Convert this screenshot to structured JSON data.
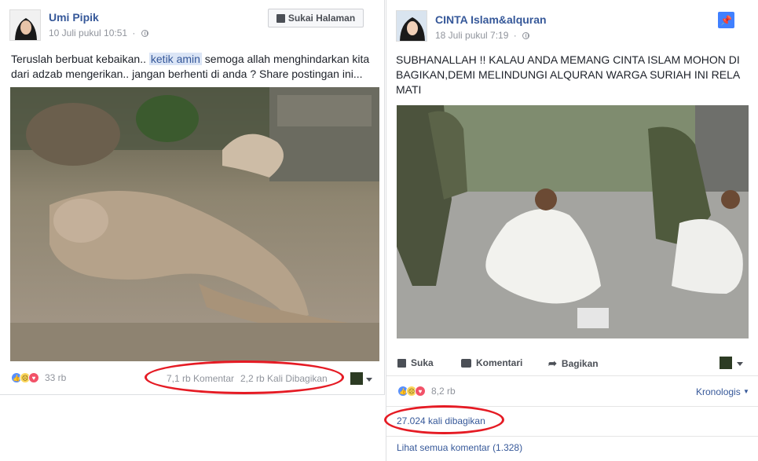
{
  "post1": {
    "author": "Umi Pipik",
    "timestamp": "10 Juli pukul 10:51",
    "like_page_label": "Sukai Halaman",
    "text_before": "Teruslah berbuat kebaikan.. ",
    "text_highlight": "ketik amin",
    "text_after": " semoga allah menghindarkan kita dari adzab mengerikan.. jangan berhenti di anda ? Share postingan ini...",
    "reaction_count": "33 rb",
    "comments": "7,1 rb Komentar",
    "shares": "2,2 rb Kali Dibagikan",
    "colors": {
      "accent": "#365899",
      "highlight_bg": "#dbe5f6",
      "annotation": "#e51b24"
    }
  },
  "post2": {
    "author": "CINTA Islam&alquran",
    "timestamp": "18 Juli pukul 7:19",
    "text": "SUBHANALLAH !! KALAU ANDA MEMANG CINTA ISLAM MOHON DI BAGIKAN,DEMI MELINDUNGI ALQURAN WARGA SURIAH INI RELA MATI",
    "actions": {
      "like": "Suka",
      "comment": "Komentari",
      "share": "Bagikan"
    },
    "reaction_count": "8,2 rb",
    "sort_label": "Kronologis",
    "share_count": "27.024 kali dibagikan",
    "view_comments": "Lihat semua komentar (1.328)"
  },
  "icons": [
    "globe-icon",
    "thumbs-up-icon",
    "pin-icon",
    "comment-icon",
    "share-arrow-icon",
    "chevron-down-icon"
  ]
}
